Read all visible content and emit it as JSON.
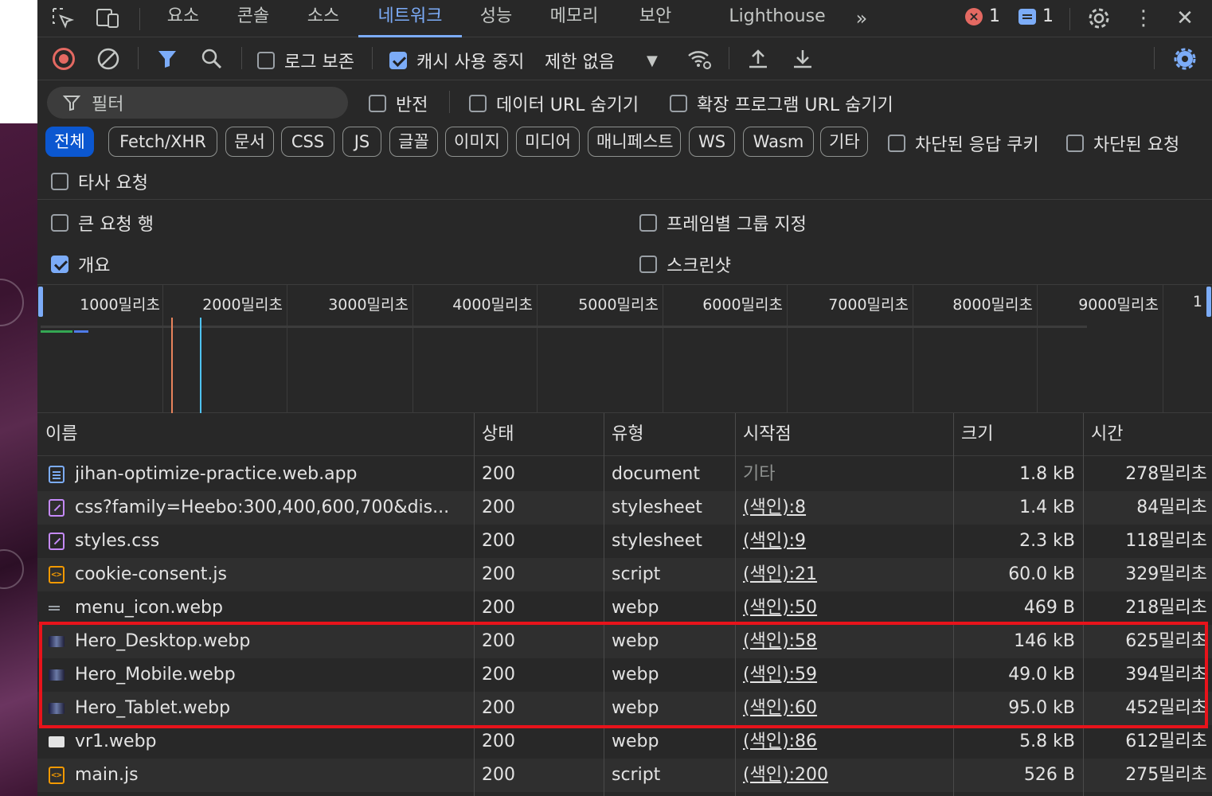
{
  "tabs": [
    "요소",
    "콘솔",
    "소스",
    "네트워크",
    "성능",
    "메모리",
    "보안",
    "Lighthouse"
  ],
  "active_tab": "네트워크",
  "status": {
    "errors": "1",
    "messages": "1"
  },
  "toolbar": {
    "preserve_log": "로그 보존",
    "disable_cache": "캐시 사용 중지",
    "throttling": "제한 없음"
  },
  "filter": {
    "placeholder": "필터",
    "invert": "반전",
    "hide_data_urls": "데이터 URL 숨기기",
    "hide_extension_urls": "확장 프로그램 URL 숨기기"
  },
  "type_filters": [
    "전체",
    "Fetch/XHR",
    "문서",
    "CSS",
    "JS",
    "글꼴",
    "이미지",
    "미디어",
    "매니페스트",
    "WS",
    "Wasm",
    "기타"
  ],
  "blocked_cookies": "차단된 응답 쿠키",
  "blocked_requests": "차단된 요청",
  "third_party": "타사 요청",
  "settings": {
    "large_rows": "큰 요청 행",
    "group_by_frame": "프레임별 그룹 지정",
    "overview": "개요",
    "screenshots": "스크린샷"
  },
  "overview_ticks": [
    "1000밀리초",
    "2000밀리초",
    "3000밀리초",
    "4000밀리초",
    "5000밀리초",
    "6000밀리초",
    "7000밀리초",
    "8000밀리초",
    "9000밀리초",
    "1"
  ],
  "columns": [
    "이름",
    "상태",
    "유형",
    "시작점",
    "크기",
    "시간"
  ],
  "rows": [
    {
      "icon": "document-icon",
      "name": "jihan-optimize-practice.web.app",
      "status": "200",
      "type": "document",
      "initiator": "기타",
      "size": "1.8 kB",
      "time": "278밀리초"
    },
    {
      "icon": "stylesheet-icon",
      "name": "css?family=Heebo:300,400,600,700&dis...",
      "status": "200",
      "type": "stylesheet",
      "initiator": "(색인):8",
      "size": "1.4 kB",
      "time": "84밀리초"
    },
    {
      "icon": "stylesheet-icon",
      "name": "styles.css",
      "status": "200",
      "type": "stylesheet",
      "initiator": "(색인):9",
      "size": "2.3 kB",
      "time": "118밀리초"
    },
    {
      "icon": "script-icon",
      "name": "cookie-consent.js",
      "status": "200",
      "type": "script",
      "initiator": "(색인):21",
      "size": "60.0 kB",
      "time": "329밀리초"
    },
    {
      "icon": "menu-image-icon",
      "name": "menu_icon.webp",
      "status": "200",
      "type": "webp",
      "initiator": "(색인):50",
      "size": "469 B",
      "time": "218밀리초"
    },
    {
      "icon": "hero-image-icon",
      "name": "Hero_Desktop.webp",
      "status": "200",
      "type": "webp",
      "initiator": "(색인):58",
      "size": "146 kB",
      "time": "625밀리초"
    },
    {
      "icon": "hero-image-icon",
      "name": "Hero_Mobile.webp",
      "status": "200",
      "type": "webp",
      "initiator": "(색인):59",
      "size": "49.0 kB",
      "time": "394밀리초"
    },
    {
      "icon": "hero-image-icon",
      "name": "Hero_Tablet.webp",
      "status": "200",
      "type": "webp",
      "initiator": "(색인):60",
      "size": "95.0 kB",
      "time": "452밀리초"
    },
    {
      "icon": "image-icon",
      "name": "vr1.webp",
      "status": "200",
      "type": "webp",
      "initiator": "(색인):86",
      "size": "5.8 kB",
      "time": "612밀리초"
    },
    {
      "icon": "script-icon",
      "name": "main.js",
      "status": "200",
      "type": "script",
      "initiator": "(색인):200",
      "size": "526 B",
      "time": "275밀리초"
    }
  ],
  "colors": {
    "accent": "#7cacf8",
    "record": "#e46962",
    "highlight_box": "#e8131b",
    "active_chip": "#0b57d0"
  }
}
